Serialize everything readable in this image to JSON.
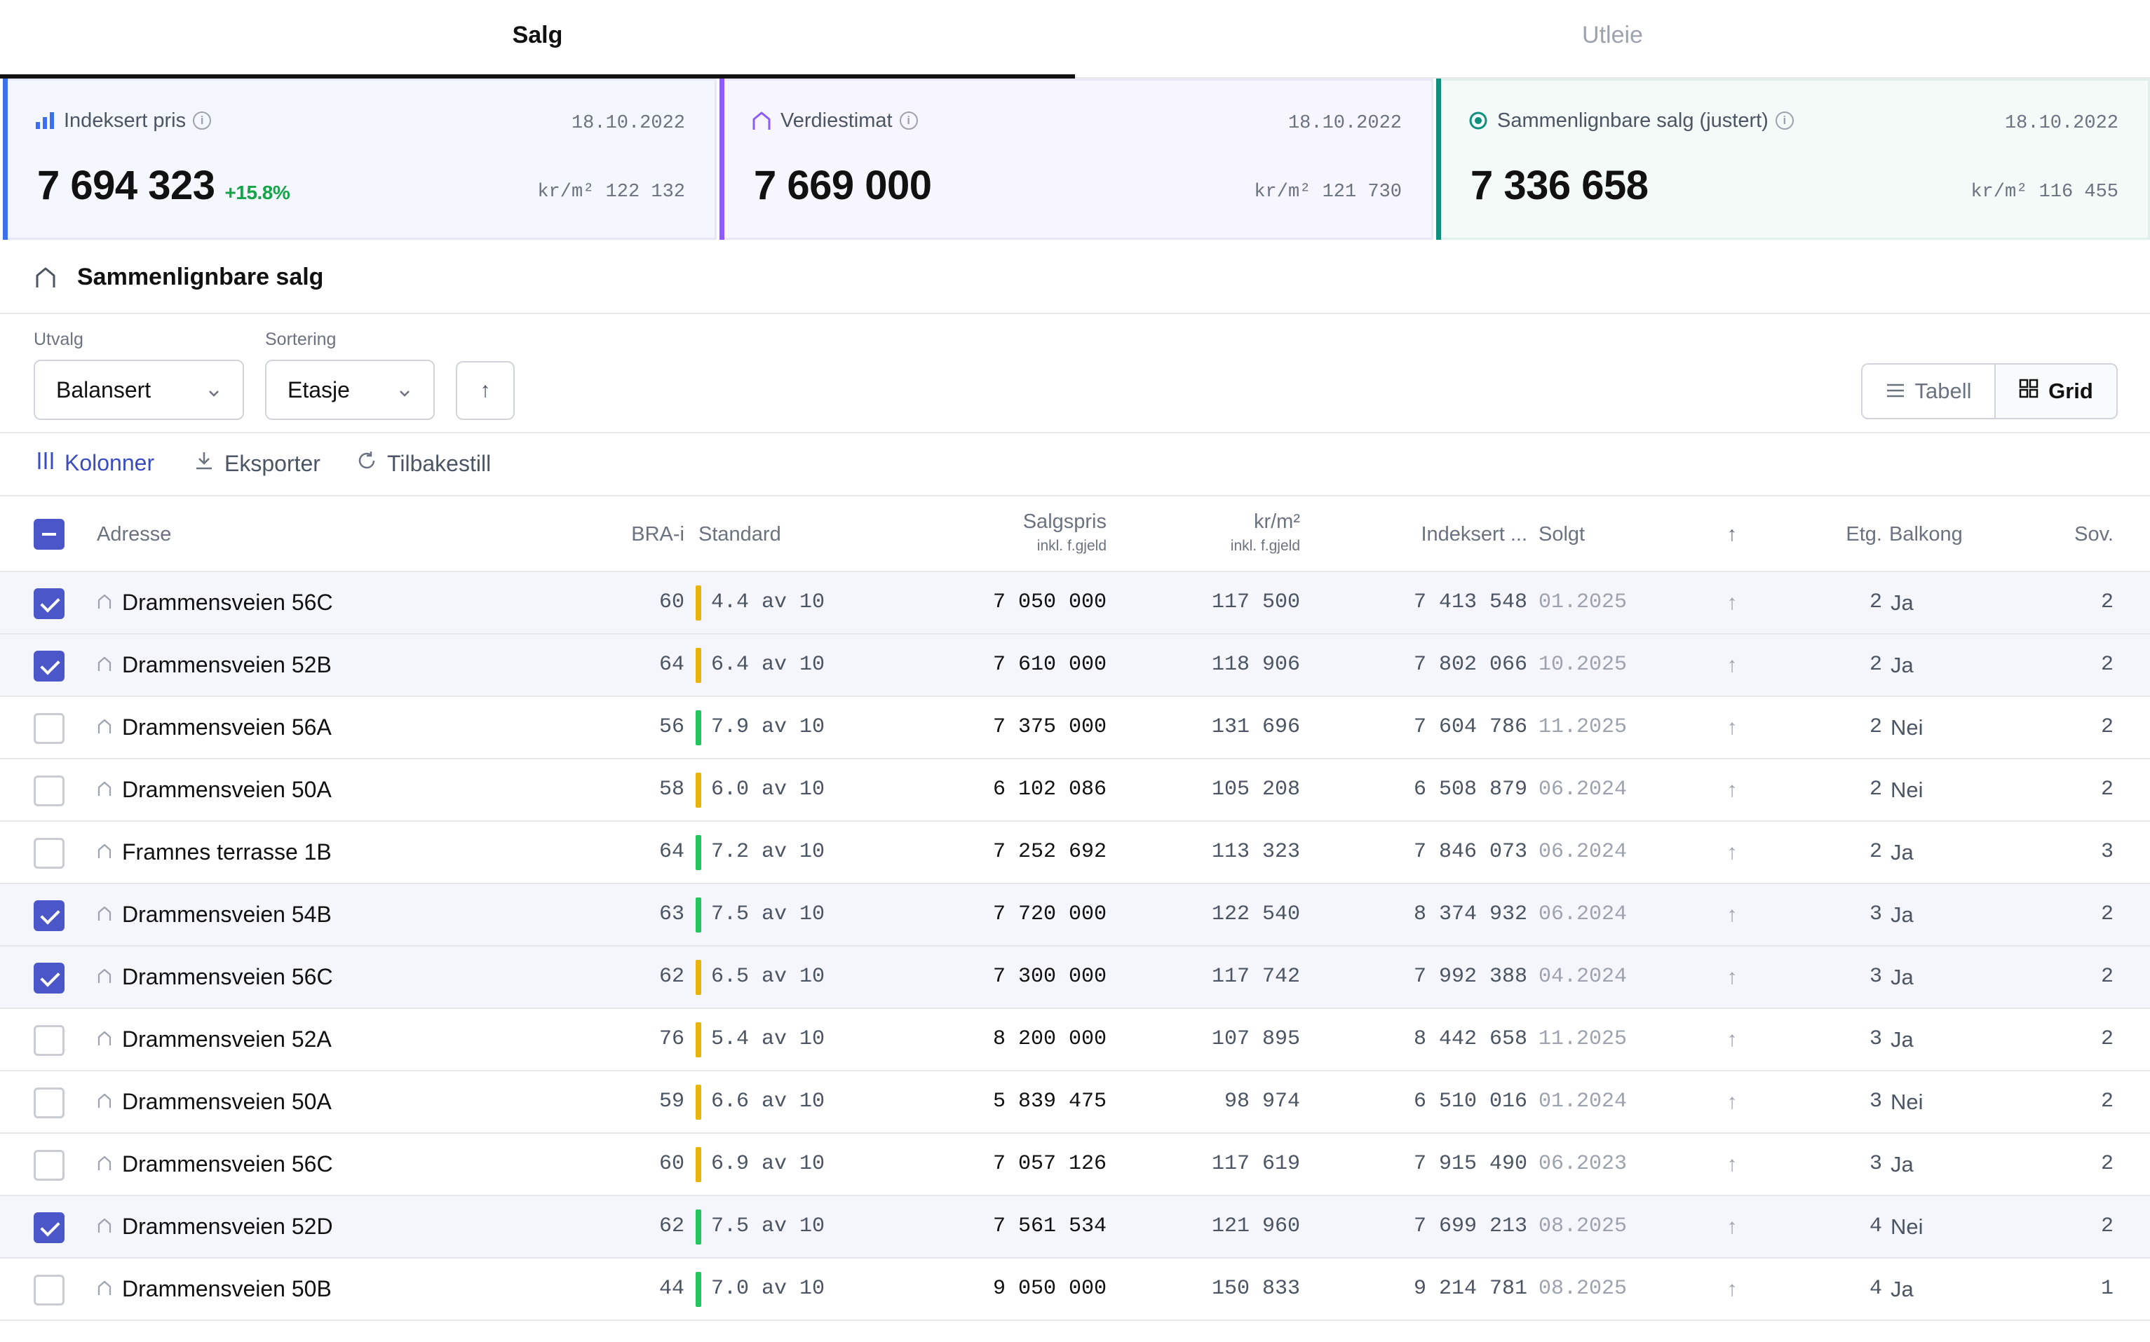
{
  "tabs": [
    {
      "label": "Salg",
      "active": true
    },
    {
      "label": "Utleie",
      "active": false
    }
  ],
  "cards": [
    {
      "label": "Indeksert pris",
      "date": "18.10.2022",
      "value": "7 694 323",
      "delta": "+15.8%",
      "perm2": "kr/m² 122 132",
      "icon": "bar-chart-icon",
      "accent": "#3b6ff0"
    },
    {
      "label": "Verdiestimat",
      "date": "18.10.2022",
      "value": "7 669 000",
      "delta": "",
      "perm2": "kr/m² 121 730",
      "icon": "house-icon",
      "accent": "#8b5cf6"
    },
    {
      "label": "Sammenlignbare salg (justert)",
      "date": "18.10.2022",
      "value": "7 336 658",
      "delta": "",
      "perm2": "kr/m² 116 455",
      "icon": "target-icon",
      "accent": "#0f8f7e"
    }
  ],
  "section": {
    "title": "Sammenlignbare salg"
  },
  "filters": {
    "utvalg_label": "Utvalg",
    "utvalg_value": "Balansert",
    "sortering_label": "Sortering",
    "sortering_value": "Etasje",
    "sort_direction_icon": "↑",
    "view_tabell": "Tabell",
    "view_grid": "Grid"
  },
  "toolbar": {
    "kolonner": "Kolonner",
    "eksporter": "Eksporter",
    "tilbakestill": "Tilbakestill"
  },
  "columns": {
    "adresse": "Adresse",
    "bra": "BRA-i",
    "standard": "Standard",
    "salgspris": "Salgspris",
    "salgspris_sub": "inkl. f.gjeld",
    "krm": "kr/m²",
    "krm_sub": "inkl. f.gjeld",
    "indeksert": "Indeksert ...",
    "solgt": "Solgt",
    "arrow": "↑",
    "etg": "Etg.",
    "balkong": "Balkong",
    "sov": "Sov."
  },
  "rows": [
    {
      "checked": true,
      "adresse": "Drammensveien 56C",
      "bra": "60",
      "std": "4.4 av 10",
      "std_color": "#eab308",
      "pris": "7 050 000",
      "krm": "117 500",
      "idx": "7 413 548",
      "solgt": "01.2025",
      "arr": "↑",
      "etg": "2",
      "balk": "Ja",
      "sov": "2"
    },
    {
      "checked": true,
      "adresse": "Drammensveien 52B",
      "bra": "64",
      "std": "6.4 av 10",
      "std_color": "#eab308",
      "pris": "7 610 000",
      "krm": "118 906",
      "idx": "7 802 066",
      "solgt": "10.2025",
      "arr": "↑",
      "etg": "2",
      "balk": "Ja",
      "sov": "2"
    },
    {
      "checked": false,
      "adresse": "Drammensveien 56A",
      "bra": "56",
      "std": "7.9 av 10",
      "std_color": "#22c55e",
      "pris": "7 375 000",
      "krm": "131 696",
      "idx": "7 604 786",
      "solgt": "11.2025",
      "arr": "↑",
      "etg": "2",
      "balk": "Nei",
      "sov": "2"
    },
    {
      "checked": false,
      "adresse": "Drammensveien 50A",
      "bra": "58",
      "std": "6.0 av 10",
      "std_color": "#eab308",
      "pris": "6 102 086",
      "krm": "105 208",
      "idx": "6 508 879",
      "solgt": "06.2024",
      "arr": "↑",
      "etg": "2",
      "balk": "Nei",
      "sov": "2"
    },
    {
      "checked": false,
      "adresse": "Framnes terrasse 1B",
      "bra": "64",
      "std": "7.2 av 10",
      "std_color": "#22c55e",
      "pris": "7 252 692",
      "krm": "113 323",
      "idx": "7 846 073",
      "solgt": "06.2024",
      "arr": "↑",
      "etg": "2",
      "balk": "Ja",
      "sov": "3"
    },
    {
      "checked": true,
      "adresse": "Drammensveien 54B",
      "bra": "63",
      "std": "7.5 av 10",
      "std_color": "#22c55e",
      "pris": "7 720 000",
      "krm": "122 540",
      "idx": "8 374 932",
      "solgt": "06.2024",
      "arr": "↑",
      "etg": "3",
      "balk": "Ja",
      "sov": "2"
    },
    {
      "checked": true,
      "adresse": "Drammensveien 56C",
      "bra": "62",
      "std": "6.5 av 10",
      "std_color": "#eab308",
      "pris": "7 300 000",
      "krm": "117 742",
      "idx": "7 992 388",
      "solgt": "04.2024",
      "arr": "↑",
      "etg": "3",
      "balk": "Ja",
      "sov": "2"
    },
    {
      "checked": false,
      "adresse": "Drammensveien 52A",
      "bra": "76",
      "std": "5.4 av 10",
      "std_color": "#eab308",
      "pris": "8 200 000",
      "krm": "107 895",
      "idx": "8 442 658",
      "solgt": "11.2025",
      "arr": "↑",
      "etg": "3",
      "balk": "Ja",
      "sov": "2"
    },
    {
      "checked": false,
      "adresse": "Drammensveien 50A",
      "bra": "59",
      "std": "6.6 av 10",
      "std_color": "#eab308",
      "pris": "5 839 475",
      "krm": "98 974",
      "idx": "6 510 016",
      "solgt": "01.2024",
      "arr": "↑",
      "etg": "3",
      "balk": "Nei",
      "sov": "2"
    },
    {
      "checked": false,
      "adresse": "Drammensveien 56C",
      "bra": "60",
      "std": "6.9 av 10",
      "std_color": "#eab308",
      "pris": "7 057 126",
      "krm": "117 619",
      "idx": "7 915 490",
      "solgt": "06.2023",
      "arr": "↑",
      "etg": "3",
      "balk": "Ja",
      "sov": "2"
    },
    {
      "checked": true,
      "adresse": "Drammensveien 52D",
      "bra": "62",
      "std": "7.5 av 10",
      "std_color": "#22c55e",
      "pris": "7 561 534",
      "krm": "121 960",
      "idx": "7 699 213",
      "solgt": "08.2025",
      "arr": "↑",
      "etg": "4",
      "balk": "Nei",
      "sov": "2"
    },
    {
      "checked": false,
      "adresse": "Drammensveien 50B",
      "bra": "44",
      "std": "7.0 av 10",
      "std_color": "#22c55e",
      "pris": "9 050 000",
      "krm": "150 833",
      "idx": "9 214 781",
      "solgt": "08.2025",
      "arr": "↑",
      "etg": "4",
      "balk": "Ja",
      "sov": "1"
    }
  ]
}
